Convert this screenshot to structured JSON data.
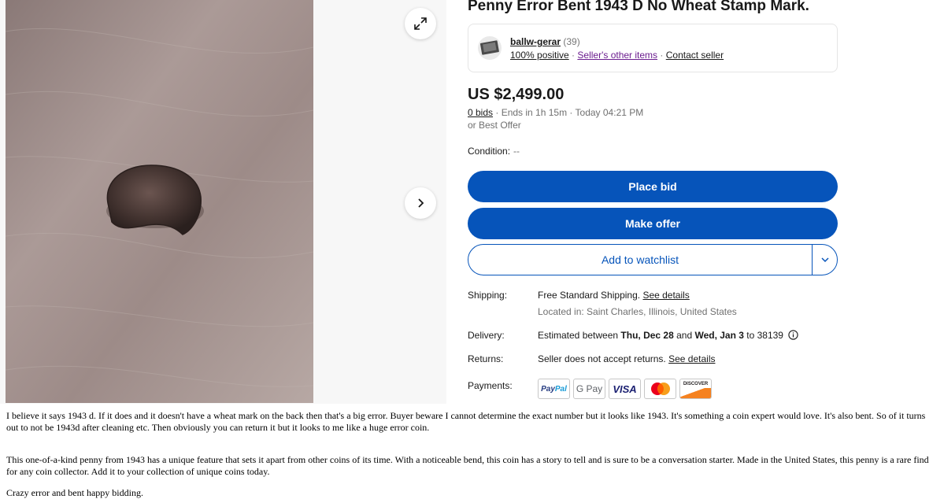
{
  "listing": {
    "title": "Penny Error Bent 1943 D No Wheat Stamp Mark."
  },
  "seller": {
    "name": "ballw-gerar",
    "feedback_count": "(39)",
    "positive": "100% positive",
    "sep1": " · ",
    "other_items": "Seller's other items",
    "sep2": " · ",
    "contact": "Contact seller"
  },
  "pricing": {
    "price": "US $2,499.00",
    "bids": "0 bids",
    "ends": " · Ends in 1h 15m · Today 04:21 PM",
    "best_offer": "or Best Offer"
  },
  "condition": {
    "label": "Condition:",
    "value": "--"
  },
  "actions": {
    "place_bid": "Place bid",
    "make_offer": "Make offer",
    "watchlist": "Add to watchlist"
  },
  "shipping": {
    "label": "Shipping:",
    "value": "Free Standard Shipping.",
    "link": "See details",
    "location": "Located in: Saint Charles, Illinois, United States"
  },
  "delivery": {
    "label": "Delivery:",
    "prefix": "Estimated between ",
    "start": "Thu, Dec 28",
    "and": " and ",
    "end": "Wed, Jan 3",
    "to": " to 38139"
  },
  "returns": {
    "label": "Returns:",
    "value": "Seller does not accept returns.",
    "link": "See details"
  },
  "payments": {
    "label": "Payments:",
    "methods": [
      "PayPal",
      "G Pay",
      "VISA",
      "Mastercard",
      "DISCOVER"
    ]
  },
  "description": {
    "p1": "I believe it says 1943 d. If it does and it doesn't have a wheat mark on the back then that's a big error. Buyer beware I cannot determine the exact number but it looks like 1943. It's something a coin expert would love. It's also bent. So of it turns out to not be 1943d after cleaning etc. Then obviously you can return it but it looks to me like a huge error coin.",
    "p2": "This one-of-a-kind penny from 1943 has a unique feature that sets it apart from other coins of its time. With a noticeable bend, this coin has a story to tell and is sure to be a conversation starter. Made in the United States, this penny is a rare find for any coin collector. Add it to your collection of unique coins today.",
    "p3": "Crazy error and bent happy bidding."
  },
  "colors": {
    "primary_blue": "#0654ba",
    "text": "#191919",
    "muted": "#707070",
    "link_purple": "#6b1d8f"
  },
  "icons": [
    "expand-icon",
    "chevron-right-icon",
    "chevron-down-icon",
    "info-icon",
    "seller-avatar"
  ]
}
